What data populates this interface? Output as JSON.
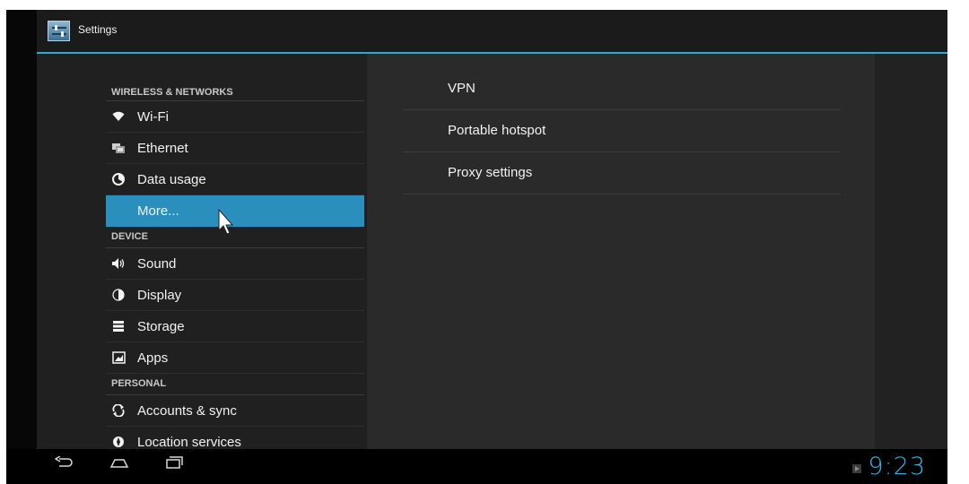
{
  "app": {
    "title": "Settings"
  },
  "sections": {
    "wireless": {
      "header": "WIRELESS & NETWORKS",
      "items": [
        {
          "label": "Wi-Fi",
          "icon": "wifi-icon"
        },
        {
          "label": "Ethernet",
          "icon": "ethernet-icon"
        },
        {
          "label": "Data usage",
          "icon": "data-usage-icon"
        },
        {
          "label": "More...",
          "icon": "",
          "selected": true
        }
      ]
    },
    "device": {
      "header": "DEVICE",
      "items": [
        {
          "label": "Sound",
          "icon": "speaker-icon"
        },
        {
          "label": "Display",
          "icon": "display-icon"
        },
        {
          "label": "Storage",
          "icon": "storage-icon"
        },
        {
          "label": "Apps",
          "icon": "apps-icon"
        }
      ]
    },
    "personal": {
      "header": "PERSONAL",
      "items": [
        {
          "label": "Accounts & sync",
          "icon": "sync-icon"
        },
        {
          "label": "Location services",
          "icon": "location-icon"
        }
      ]
    }
  },
  "detail": {
    "items": [
      {
        "label": "VPN"
      },
      {
        "label": "Portable hotspot"
      },
      {
        "label": "Proxy settings"
      }
    ]
  },
  "statusbar": {
    "time": "9:23"
  },
  "colors": {
    "accent": "#33b5e5",
    "selected": "#2a8fbd"
  }
}
